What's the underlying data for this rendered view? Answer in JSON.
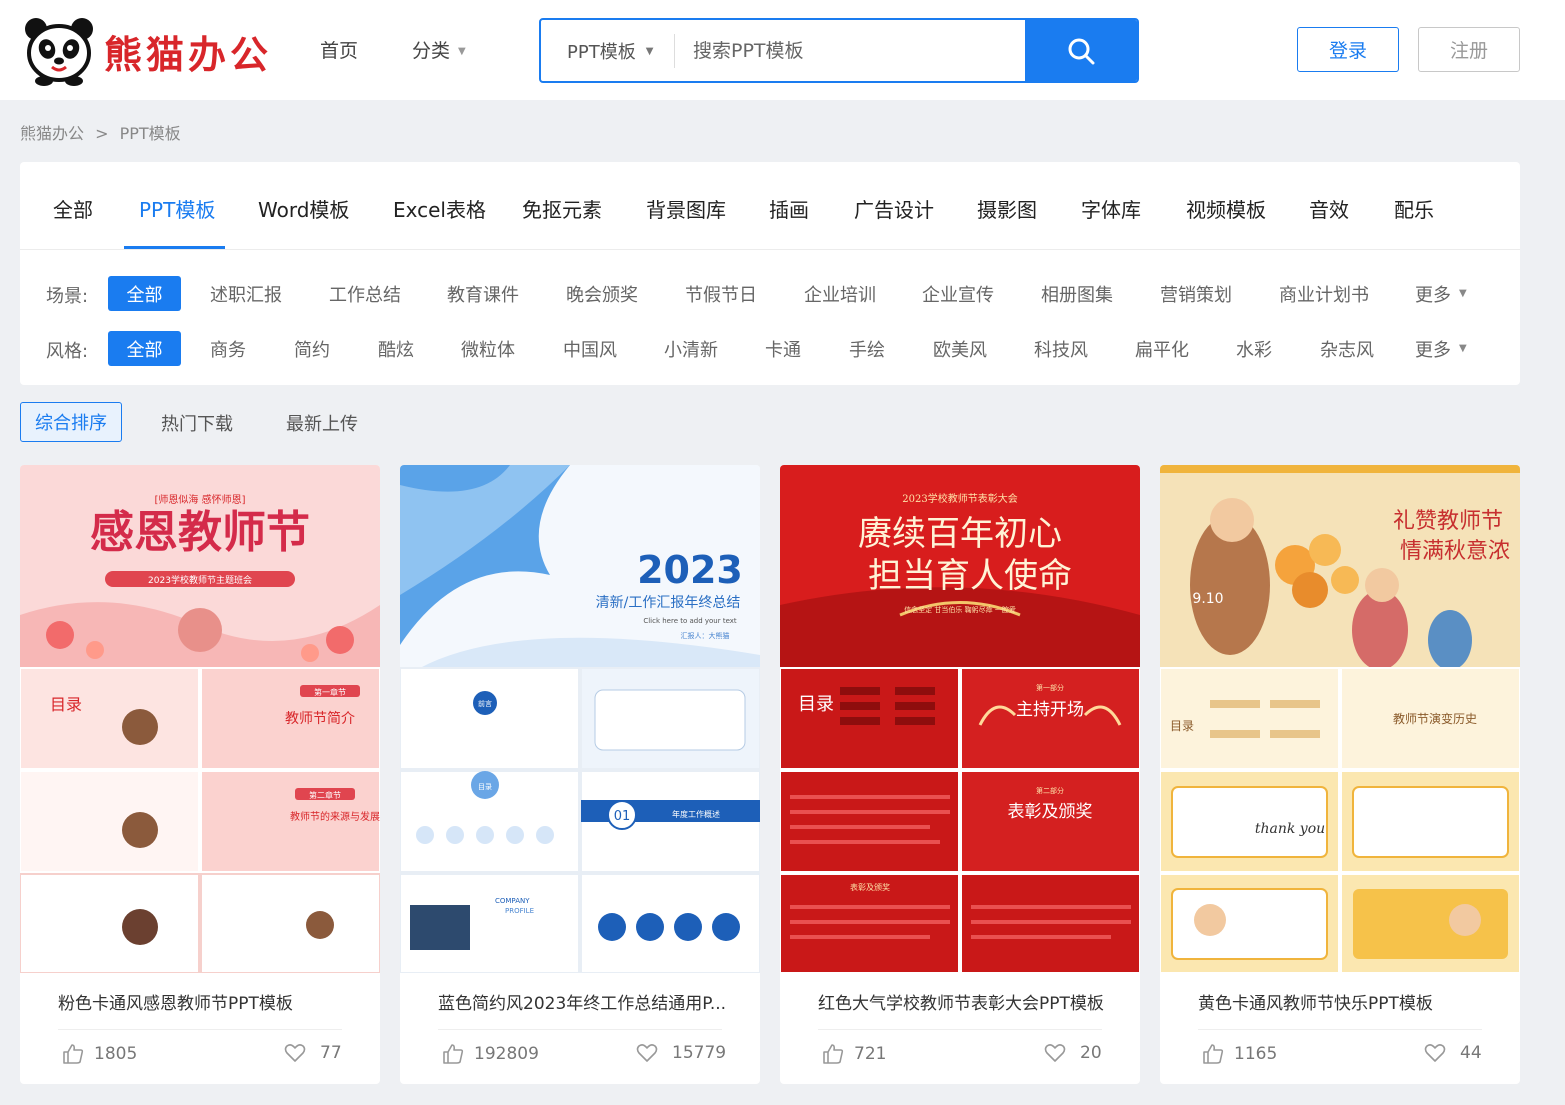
{
  "header": {
    "logo_text": "熊猫办公",
    "nav": [
      {
        "label": "首页"
      },
      {
        "label": "分类"
      }
    ],
    "search": {
      "type_label": "PPT模板",
      "placeholder": "搜索PPT模板"
    },
    "login_label": "登录",
    "register_label": "注册"
  },
  "breadcrumb": {
    "home": "熊猫办公",
    "separator": ">",
    "current": "PPT模板"
  },
  "categories": [
    "全部",
    "PPT模板",
    "Word模板",
    "Excel表格",
    "免抠元素",
    "背景图库",
    "插画",
    "广告设计",
    "摄影图",
    "字体库",
    "视频模板",
    "音效",
    "配乐"
  ],
  "filters": {
    "scene": {
      "label": "场景:",
      "items": [
        "全部",
        "述职汇报",
        "工作总结",
        "教育课件",
        "晚会颁奖",
        "节假节日",
        "企业培训",
        "企业宣传",
        "相册图集",
        "营销策划",
        "商业计划书",
        "更多"
      ]
    },
    "style": {
      "label": "风格:",
      "items": [
        "全部",
        "商务",
        "简约",
        "酷炫",
        "微粒体",
        "中国风",
        "小清新",
        "卡通",
        "手绘",
        "欧美风",
        "科技风",
        "扁平化",
        "水彩",
        "杂志风",
        "更多"
      ]
    }
  },
  "sort": [
    "综合排序",
    "热门下载",
    "最新上传"
  ],
  "cards": [
    {
      "title": "粉色卡通风感恩教师节PPT模板",
      "likes": "1805",
      "favorites": "77",
      "cover_heading": "感恩教师节",
      "cover_sub": "2023学校教师节主题班会",
      "cover_tag": "[师恩似海  感怀师恩]",
      "slide_texts": [
        "目录",
        "第一章节",
        "教师节简介",
        "第二章节",
        "教师节的来源与发展"
      ]
    },
    {
      "title": "蓝色简约风2023年终工作总结通用P...",
      "likes": "192809",
      "favorites": "15779",
      "cover_heading": "2023",
      "cover_sub": "清新/工作汇报年终总结",
      "cover_small": "Click here to add your text",
      "cover_author": "汇报人：大熊猫",
      "slide_texts": [
        "前言",
        "目录",
        "01",
        "年度工作概述",
        "COMPANY",
        "PROFILE"
      ]
    },
    {
      "title": "红色大气学校教师节表彰大会PPT模板",
      "likes": "721",
      "favorites": "20",
      "cover_top": "2023学校教师节表彰大会",
      "cover_line1": "赓续百年初心",
      "cover_line2": "担当育人使命",
      "cover_sub": "信念坚定  甘当伯乐  鞠躬尽瘁  一腔爱",
      "slide_texts": [
        "目录",
        "第一部分",
        "主持开场",
        "第二部分",
        "表彰及颁奖",
        "表彰及颁奖"
      ]
    },
    {
      "title": "黄色卡通风教师节快乐PPT模板",
      "likes": "1165",
      "favorites": "44",
      "cover_line1": "礼赞教师节",
      "cover_line2": "情满秋意浓",
      "cover_date": "9.10",
      "slide_texts": [
        "目录",
        "教师节演变历史",
        "thank you"
      ]
    }
  ],
  "colors": {
    "accent": "#1a7cf0",
    "brand_red": "#d8262a"
  }
}
